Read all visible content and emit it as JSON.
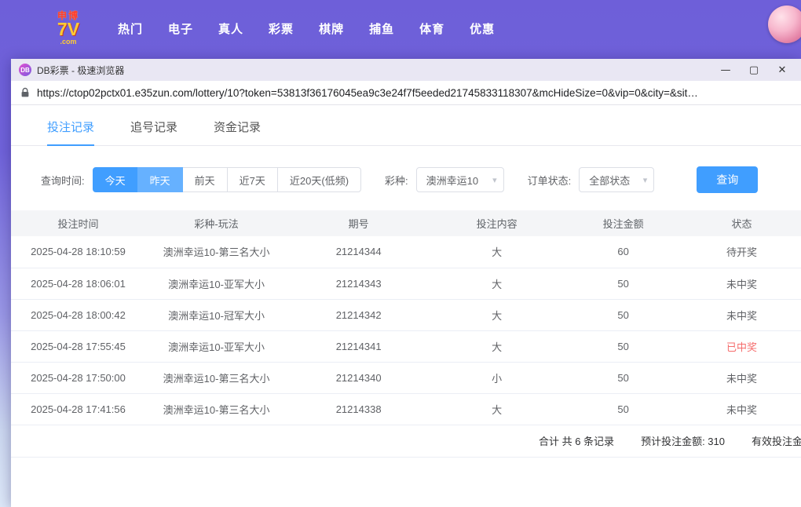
{
  "colors": {
    "accent": "#409eff",
    "accent_light": "#66b1ff",
    "win_red": "#f56c6c",
    "topbar_purple": "#6e5fd9"
  },
  "topbar": {
    "logo": {
      "line1": "申博",
      "line2": "7V",
      "line3": ".com"
    },
    "nav": [
      "热门",
      "电子",
      "真人",
      "彩票",
      "棋牌",
      "捕鱼",
      "体育",
      "优惠"
    ]
  },
  "window": {
    "title": "DB彩票 - 极速浏览器",
    "favicon_text": "DB",
    "controls": {
      "minimize": "—",
      "maximize": "▢",
      "close": "✕"
    },
    "url": "https://ctop02pctx01.e35zun.com/lottery/10?token=53813f36176045ea9c3e24f7f5eeded21745833118307&mcHideSize=0&vip=0&city=&sit…"
  },
  "tabs": [
    {
      "label": "投注记录",
      "active": true
    },
    {
      "label": "追号记录",
      "active": false
    },
    {
      "label": "资金记录",
      "active": false
    }
  ],
  "filters": {
    "time_label": "查询时间:",
    "time_buttons": [
      {
        "label": "今天",
        "style": "primary"
      },
      {
        "label": "昨天",
        "style": "primary-light"
      },
      {
        "label": "前天",
        "style": "plain"
      },
      {
        "label": "近7天",
        "style": "plain"
      },
      {
        "label": "近20天(低频)",
        "style": "plain"
      }
    ],
    "lottery_label": "彩种:",
    "lottery_value": "澳洲幸运10",
    "status_label": "订单状态:",
    "status_value": "全部状态",
    "search_button": "查询"
  },
  "icons": {
    "caret": "▾"
  },
  "table": {
    "headers": [
      "投注时间",
      "彩种-玩法",
      "期号",
      "投注内容",
      "投注金额",
      "状态"
    ],
    "rows": [
      {
        "time": "2025-04-28 18:10:59",
        "play": "澳洲幸运10-第三名大小",
        "issue": "21214344",
        "content": "大",
        "amount": "60",
        "status": "待开奖",
        "win": false
      },
      {
        "time": "2025-04-28 18:06:01",
        "play": "澳洲幸运10-亚军大小",
        "issue": "21214343",
        "content": "大",
        "amount": "50",
        "status": "未中奖",
        "win": false
      },
      {
        "time": "2025-04-28 18:00:42",
        "play": "澳洲幸运10-冠军大小",
        "issue": "21214342",
        "content": "大",
        "amount": "50",
        "status": "未中奖",
        "win": false
      },
      {
        "time": "2025-04-28 17:55:45",
        "play": "澳洲幸运10-亚军大小",
        "issue": "21214341",
        "content": "大",
        "amount": "50",
        "status": "已中奖",
        "win": true
      },
      {
        "time": "2025-04-28 17:50:00",
        "play": "澳洲幸运10-第三名大小",
        "issue": "21214340",
        "content": "小",
        "amount": "50",
        "status": "未中奖",
        "win": false
      },
      {
        "time": "2025-04-28 17:41:56",
        "play": "澳洲幸运10-第三名大小",
        "issue": "21214338",
        "content": "大",
        "amount": "50",
        "status": "未中奖",
        "win": false
      }
    ]
  },
  "summary": {
    "total": "合计 共 6 条记录",
    "expected": "预计投注金额: 310",
    "valid": "有效投注金"
  }
}
